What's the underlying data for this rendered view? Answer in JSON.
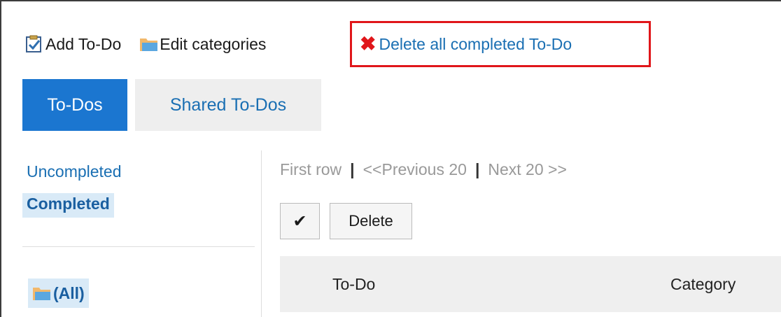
{
  "toolbar": {
    "add_todo": "Add To-Do",
    "edit_categories": "Edit categories",
    "delete_completed": "Delete all completed To-Do"
  },
  "tabs": [
    {
      "label": "To-Dos",
      "active": true
    },
    {
      "label": "Shared To-Dos",
      "active": false
    }
  ],
  "sidebar": {
    "status_items": [
      {
        "label": "Uncompleted",
        "selected": false
      },
      {
        "label": "Completed",
        "selected": true
      }
    ],
    "folder_all": "(All)"
  },
  "pager": {
    "first": "First row",
    "separator": "|",
    "previous": "<<Previous 20",
    "next": "Next 20 >>"
  },
  "actions": {
    "check_all": "✔",
    "delete": "Delete"
  },
  "table": {
    "columns": [
      "To-Do",
      "Category"
    ]
  },
  "colors": {
    "accent_blue": "#1b76d0",
    "link_blue": "#1a6fb3",
    "highlight_red": "#e0161a",
    "selected_bg": "#d9eaf7"
  }
}
